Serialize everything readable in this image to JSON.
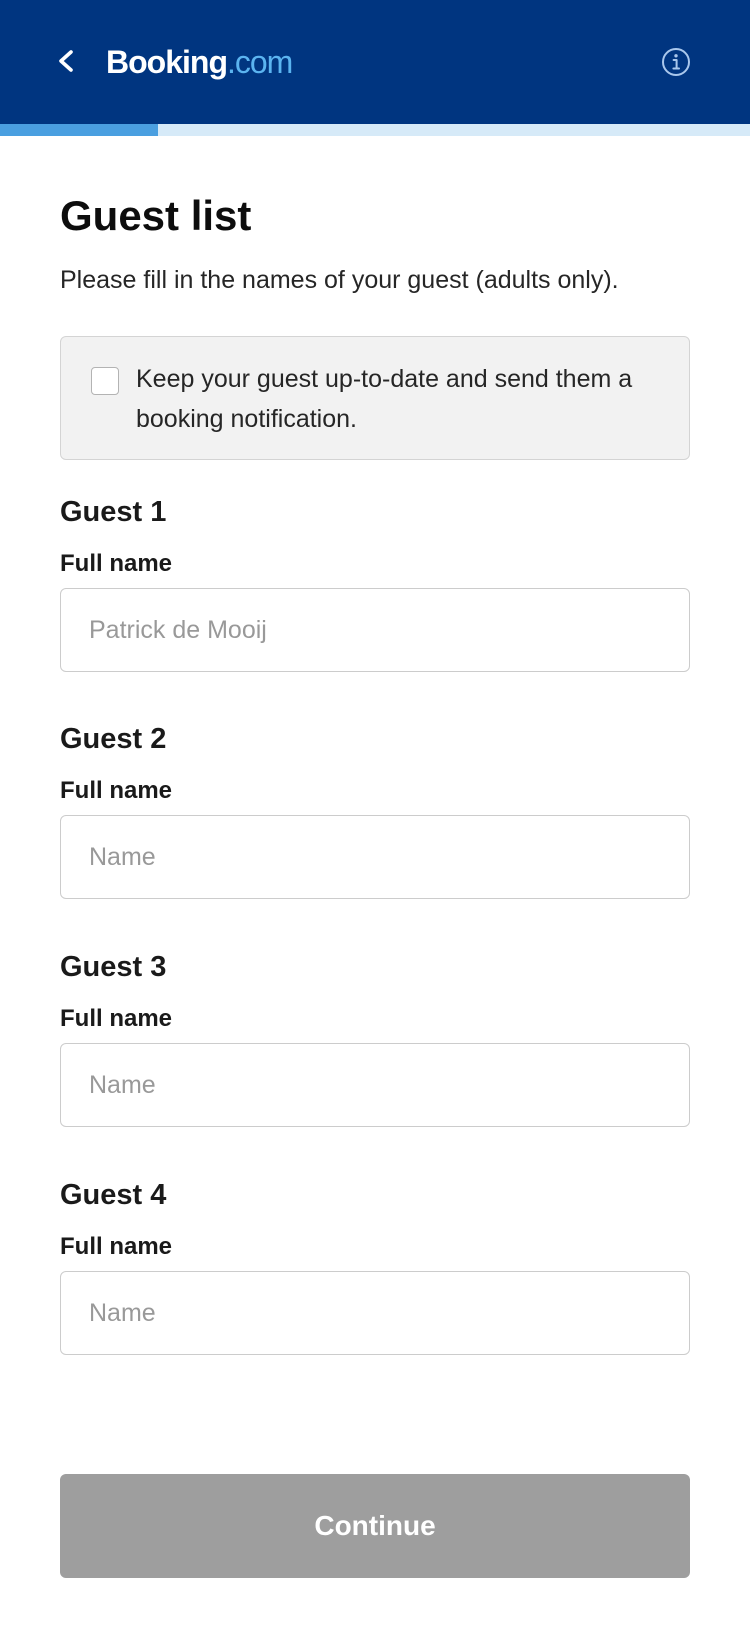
{
  "header": {
    "logo_main": "Booking",
    "logo_suffix": ".com",
    "back_icon": "chevron-left-icon",
    "info_icon": "info-icon",
    "background_color": "#003580"
  },
  "progress": {
    "fraction": 0.21,
    "fill_color": "#4a9fe0",
    "track_color": "#d6eaf8"
  },
  "page": {
    "title": "Guest list",
    "subtitle": "Please fill in the names of your guest (adults only)."
  },
  "notification": {
    "checked": false,
    "text": "Keep your guest up-to-date and send them a booking notification."
  },
  "guests": [
    {
      "heading": "Guest 1",
      "label": "Full name",
      "placeholder": "Patrick de Mooij",
      "value": ""
    },
    {
      "heading": "Guest 2",
      "label": "Full name",
      "placeholder": "Name",
      "value": ""
    },
    {
      "heading": "Guest 3",
      "label": "Full name",
      "placeholder": "Name",
      "value": ""
    },
    {
      "heading": "Guest 4",
      "label": "Full name",
      "placeholder": "Name",
      "value": ""
    }
  ],
  "actions": {
    "continue_label": "Continue",
    "continue_enabled": false,
    "continue_color": "#9e9e9e"
  }
}
